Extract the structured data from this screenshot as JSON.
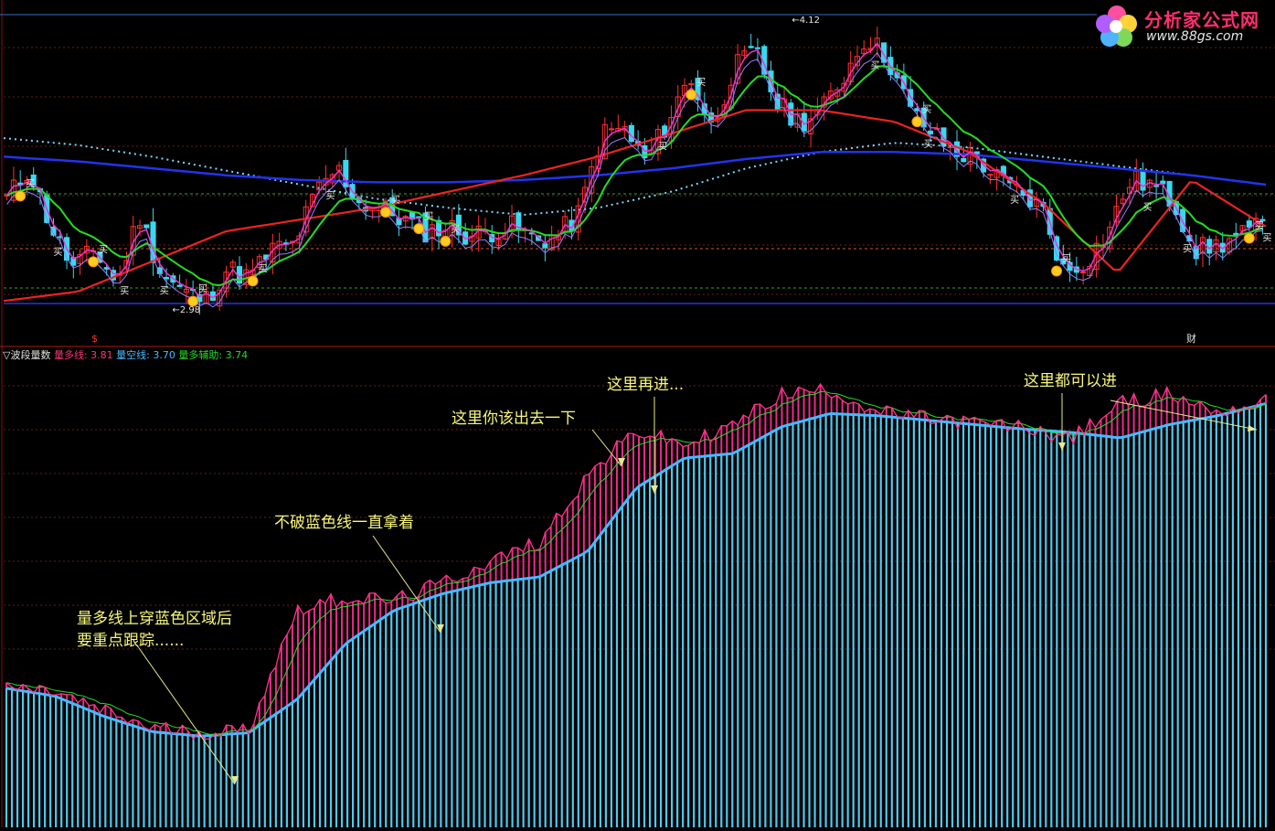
{
  "logo": {
    "brand": "分析家公式网",
    "site": "www.88gs.com"
  },
  "colors": {
    "background": "#000000",
    "up_candle": "#ff3030",
    "down_candle": "#38d8f0",
    "blue_ma": "#2233ee",
    "red_ma": "#ee2222",
    "green_ma": "#22dd22",
    "magenta_line": "#ee33cc",
    "dotted_ma": "#7ad8ff",
    "volume_bar": "#4fc8ee",
    "volume_line": "#44bbff",
    "pink_fill": "#ee2a8a",
    "annotation_text": "#f7f77a"
  },
  "price_panel": {
    "price_labels": {
      "high": "4.12",
      "low": "2.98"
    },
    "buy_signal": "买",
    "marker_left": "$",
    "marker_right": "财"
  },
  "indicator_panel": {
    "name": "▽波段量数",
    "items": [
      {
        "label": "量多线:",
        "value": "3.81",
        "color": "#ff3377"
      },
      {
        "label": "量空线:",
        "value": "3.70",
        "color": "#44bbff"
      },
      {
        "label": "量多辅助:",
        "value": "3.74",
        "color": "#22dd22"
      }
    ]
  },
  "annotations": [
    {
      "id": "track",
      "lines": [
        "量多线上穿蓝色区域后",
        "要重点跟踪......"
      ]
    },
    {
      "id": "hold",
      "lines": [
        "不破蓝色线一直拿着"
      ]
    },
    {
      "id": "exit",
      "lines": [
        "这里你该出去一下"
      ]
    },
    {
      "id": "reenter",
      "lines": [
        "这里再进..."
      ]
    },
    {
      "id": "enter_any",
      "lines": [
        "这里都可以进"
      ]
    }
  ],
  "chart_data": [
    {
      "type": "candlestick",
      "price_path": [
        3.42,
        3.55,
        3.3,
        3.12,
        3.2,
        3.05,
        3.35,
        3.1,
        3.02,
        2.98,
        3.12,
        3.08,
        3.2,
        3.22,
        3.44,
        3.55,
        3.4,
        3.38,
        3.33,
        3.28,
        3.3,
        3.26,
        3.28,
        3.3,
        3.24,
        3.26,
        3.36,
        3.7,
        3.72,
        3.58,
        3.75,
        3.95,
        3.72,
        3.98,
        4.05,
        3.82,
        3.75,
        3.8,
        3.95,
        4.12,
        4.02,
        3.8,
        3.7,
        3.62,
        3.6,
        3.5,
        3.44,
        3.38,
        3.1,
        3.15,
        3.28,
        3.5,
        3.48,
        3.4,
        3.2,
        3.22,
        3.26,
        3.3
      ],
      "ma_blue": [
        3.6,
        3.58,
        3.55,
        3.52,
        3.5,
        3.49,
        3.49,
        3.5,
        3.52,
        3.55,
        3.59,
        3.62,
        3.62,
        3.61,
        3.58,
        3.55,
        3.52,
        3.48
      ],
      "ma_red": [
        2.98,
        3.02,
        3.15,
        3.28,
        3.33,
        3.38,
        3.45,
        3.52,
        3.6,
        3.7,
        3.8,
        3.8,
        3.75,
        3.62,
        3.4,
        3.1,
        3.5,
        3.3
      ],
      "ma_dotted": [
        3.68,
        3.65,
        3.6,
        3.54,
        3.48,
        3.42,
        3.38,
        3.35,
        3.38,
        3.45,
        3.55,
        3.62,
        3.66,
        3.64,
        3.6,
        3.56,
        3.52,
        3.48
      ],
      "price_labels": [
        "4.12",
        "2.98"
      ]
    },
    {
      "type": "area",
      "series": [
        {
          "name": "量多线",
          "last": 3.81
        },
        {
          "name": "量空线",
          "last": 3.7
        },
        {
          "name": "量多辅助",
          "last": 3.74
        }
      ],
      "blue_path": [
        1.25,
        1.18,
        1.0,
        0.86,
        0.82,
        0.85,
        1.15,
        1.65,
        1.95,
        2.1,
        2.2,
        2.25,
        2.48,
        3.05,
        3.32,
        3.36,
        3.6,
        3.72,
        3.7,
        3.66,
        3.62,
        3.58,
        3.55,
        3.5,
        3.62,
        3.7,
        3.81
      ],
      "pink_path": [
        1.25,
        1.2,
        1.03,
        0.88,
        0.84,
        0.86,
        1.95,
        2.05,
        2.02,
        2.18,
        2.38,
        2.55,
        3.15,
        3.55,
        3.42,
        3.6,
        3.88,
        3.92,
        3.72,
        3.66,
        3.62,
        3.58,
        3.48,
        3.8,
        3.88,
        3.72,
        3.81
      ]
    }
  ]
}
